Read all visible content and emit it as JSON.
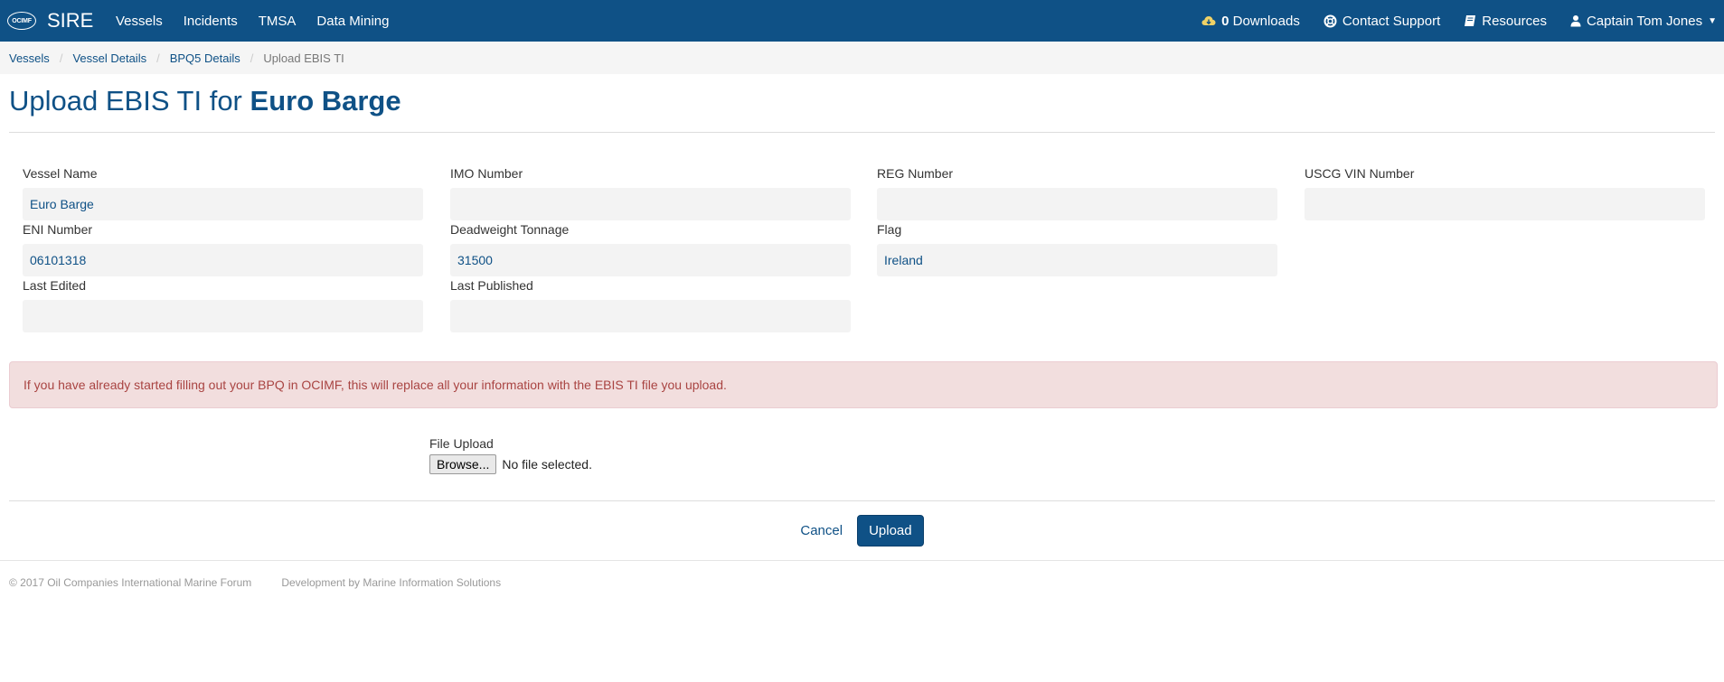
{
  "nav": {
    "logo_text": "OCIMF",
    "brand": "SIRE",
    "links": [
      "Vessels",
      "Incidents",
      "TMSA",
      "Data Mining"
    ],
    "downloads_count": "0",
    "downloads_label": "Downloads",
    "contact": "Contact Support",
    "resources": "Resources",
    "user": "Captain Tom Jones"
  },
  "breadcrumb": [
    "Vessels",
    "Vessel Details",
    "BPQ5 Details",
    "Upload EBIS TI"
  ],
  "page": {
    "title_prefix": "Upload EBIS TI for",
    "title_vessel": "Euro Barge"
  },
  "fields": [
    {
      "label": "Vessel Name",
      "value": "Euro Barge"
    },
    {
      "label": "IMO Number",
      "value": ""
    },
    {
      "label": "REG Number",
      "value": ""
    },
    {
      "label": "USCG VIN Number",
      "value": ""
    },
    {
      "label": "ENI Number",
      "value": "06101318"
    },
    {
      "label": "Deadweight Tonnage",
      "value": "31500"
    },
    {
      "label": "Flag",
      "value": "Ireland"
    },
    {
      "label": "Last Edited",
      "value": ""
    },
    {
      "label": "Last Published",
      "value": ""
    }
  ],
  "alert": "If you have already started filling out your BPQ in OCIMF, this will replace all your information with the EBIS TI file you upload.",
  "upload": {
    "label": "File Upload",
    "browse": "Browse...",
    "status": "No file selected."
  },
  "actions": {
    "cancel": "Cancel",
    "upload": "Upload"
  },
  "footer": {
    "copyright": "© 2017 Oil Companies International Marine Forum",
    "dev": "Development by Marine Information Solutions"
  },
  "colors": {
    "brand": "#0f5186",
    "downloads": "#f0d266",
    "alert_bg": "#f2dede",
    "alert_text": "#a94442"
  }
}
